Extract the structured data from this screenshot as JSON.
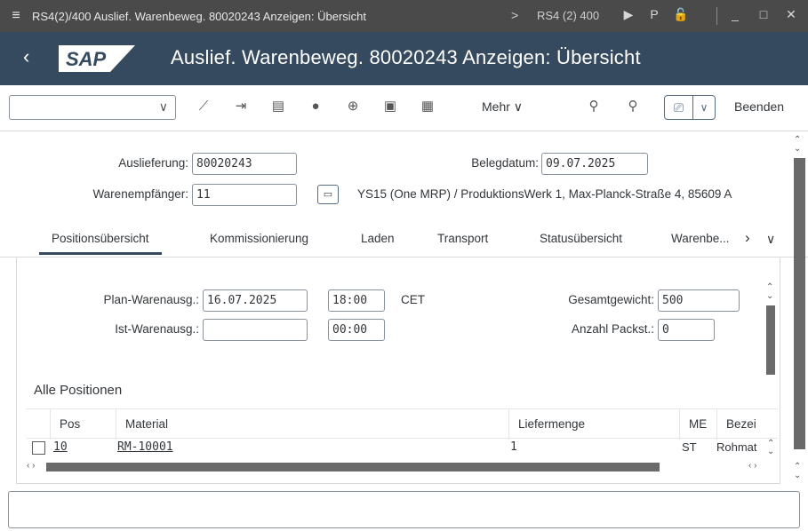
{
  "os_bar": {
    "window_title": "RS4(2)/400 Auslief. Warenbeweg. 80020243 Anzeigen: Übersicht",
    "separator": ">",
    "system": "RS4 (2) 400"
  },
  "header": {
    "back_icon": "‹",
    "logo": "SAP",
    "title": "Auslief. Warenbeweg. 80020243 Anzeigen: Übersicht"
  },
  "toolbar": {
    "command_field_value": "",
    "more_label": "Mehr",
    "exit_label": "Beenden"
  },
  "header_fields": {
    "delivery_label": "Auslieferung:",
    "delivery_value": "80020243",
    "doc_date_label": "Belegdatum:",
    "doc_date_value": "09.07.2025",
    "ship_to_label": "Warenempfänger:",
    "ship_to_value": "11",
    "ship_to_desc": "YS15 (One MRP) / ProduktionsWerk 1, Max-Planck-Straße 4, 85609 A"
  },
  "tabs": [
    {
      "label": "Positionsübersicht",
      "active": true
    },
    {
      "label": "Kommissionierung",
      "active": false
    },
    {
      "label": "Laden",
      "active": false
    },
    {
      "label": "Transport",
      "active": false
    },
    {
      "label": "Statusübersicht",
      "active": false
    },
    {
      "label": "Warenbe...",
      "active": false
    }
  ],
  "tab_panel": {
    "plan_gi_label": "Plan-Warenausg.:",
    "plan_gi_date": "16.07.2025",
    "plan_gi_time": "18:00",
    "timezone": "CET",
    "act_gi_label": "Ist-Warenausg.:",
    "act_gi_date": "",
    "act_gi_time": "00:00",
    "total_weight_label": "Gesamtgewicht:",
    "total_weight_value": "500",
    "packages_label": "Anzahl Packst.:",
    "packages_value": "0"
  },
  "items": {
    "section_title": "Alle Positionen",
    "columns": [
      "Pos",
      "Material",
      "Liefermenge",
      "ME",
      "Bezei"
    ],
    "rows": [
      {
        "pos": "10",
        "material": "RM-10001",
        "qty": "1",
        "uom": "ST",
        "desc": "Rohmat"
      }
    ]
  },
  "status_bar": {
    "message": ""
  }
}
